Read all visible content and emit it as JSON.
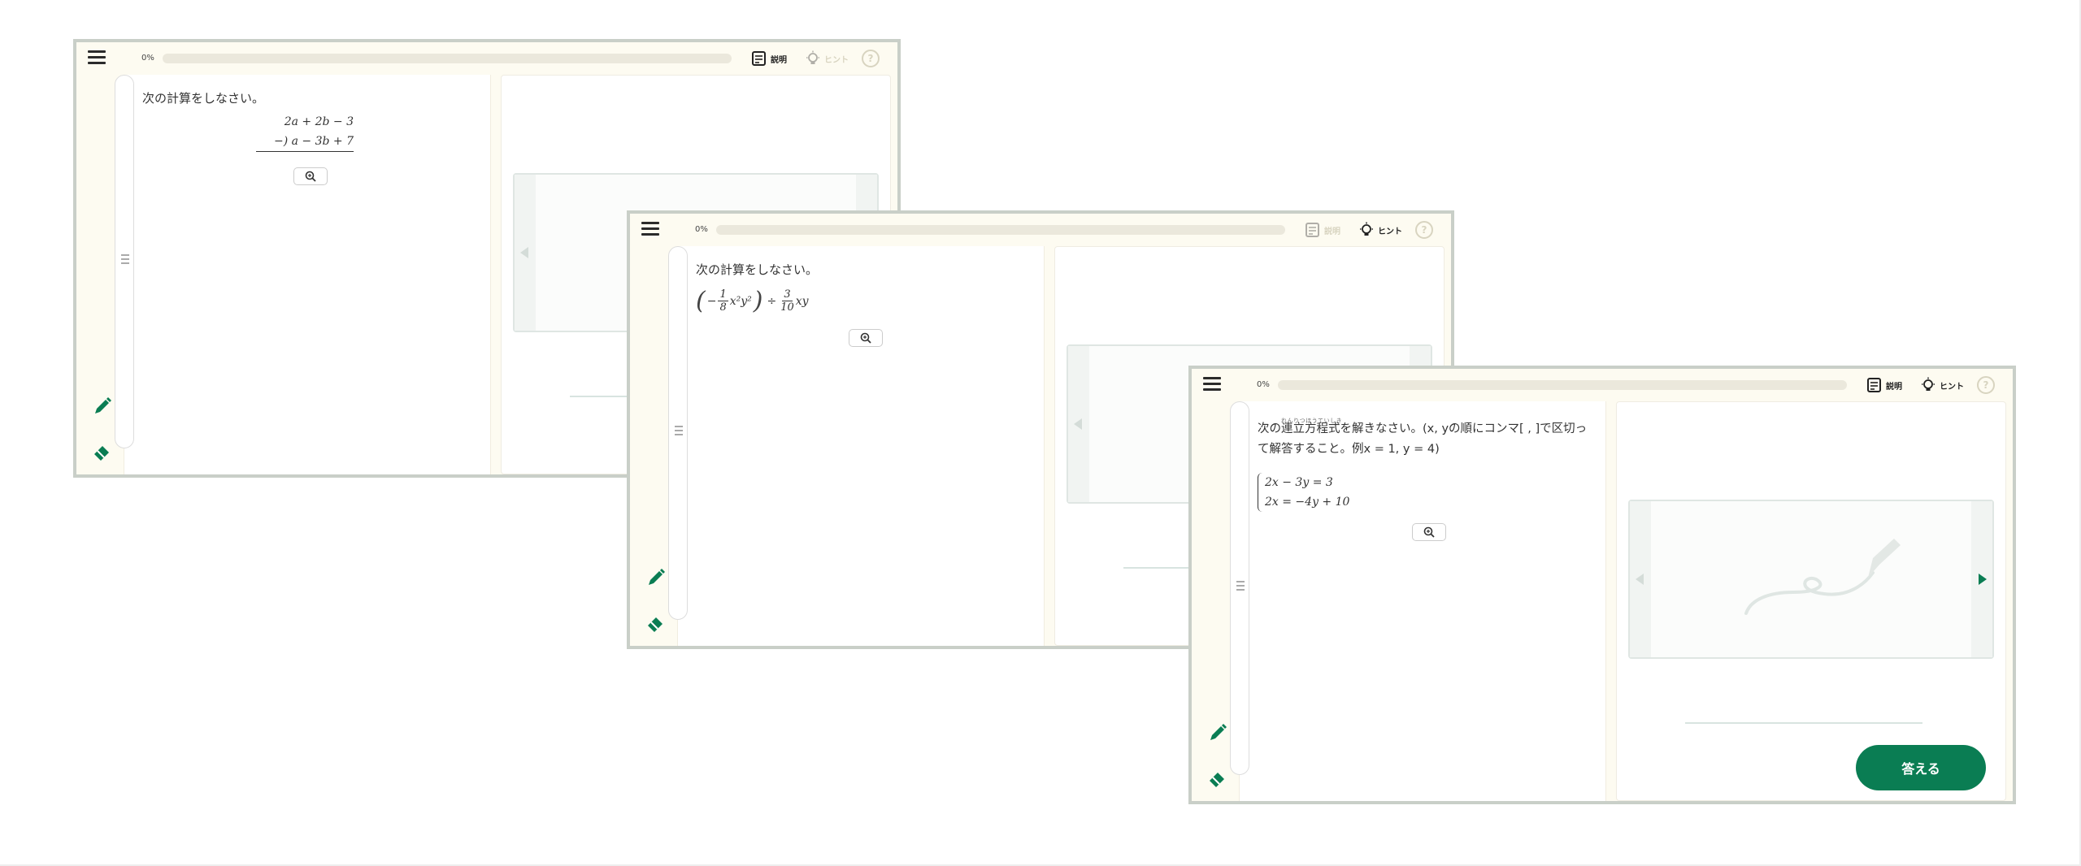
{
  "colors": {
    "accent": "#0a7d53",
    "frame": "#c9cfc8",
    "background": "#fdfbf1",
    "disabled": "#d8d4c0"
  },
  "shared": {
    "progress": "0%",
    "progress_value": 0,
    "explain_label": "説明",
    "hint_label": "ヒント",
    "help_label": "?",
    "answer_label": "答える"
  },
  "icons": [
    "menu-icon",
    "explanation-icon",
    "hint-bulb-icon",
    "help-icon",
    "pencil-icon",
    "eraser-icon",
    "zoom-in-icon",
    "arrow-left-icon",
    "arrow-right-icon"
  ],
  "screens": [
    {
      "question": "次の計算をしなさい。",
      "math_lines": [
        "2a + 2b − 3",
        "−)  a − 3b + 7"
      ]
    },
    {
      "question": "次の計算をしなさい。",
      "math": {
        "open": "(",
        "minus": "−",
        "frac1_num": "1",
        "frac1_den": "8",
        "term1": "x²y²",
        "close": ")",
        "op": "÷",
        "frac2_num": "3",
        "frac2_den": "10",
        "term2": "xy"
      }
    },
    {
      "ruby": "れんりつほうていしき",
      "question_pre": "次の",
      "question_ruby_base": "連立方程式",
      "question_post": "を解きなさい。(x, yの順にコンマ[ , ]で区切って解答すること。例x = 1, y = 4)",
      "equations": [
        "2x − 3y = 3",
        "2x = −4y + 10"
      ]
    }
  ]
}
